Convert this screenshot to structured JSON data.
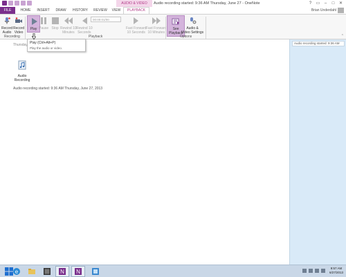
{
  "app": {
    "context_tab_group": "AUDIO & VIDEO",
    "window_title": "Audio recording started: 9:36 AM Thursday, June 27 - OneNote",
    "user": "Brian Underdahl"
  },
  "tabs": [
    {
      "label": "FILE"
    },
    {
      "label": "HOME"
    },
    {
      "label": "INSERT"
    },
    {
      "label": "DRAW"
    },
    {
      "label": "HISTORY"
    },
    {
      "label": "REVIEW"
    },
    {
      "label": "VIEW"
    },
    {
      "label": "PLAYBACK"
    }
  ],
  "ribbon": {
    "groups": {
      "recording": "Recording",
      "playback": "Playback",
      "options": "Options"
    },
    "buttons": {
      "record_audio": "Record\nAudio",
      "record_video": "Record\nVideo",
      "play": "Play",
      "pause": "Pause",
      "stop": "Stop",
      "rewind10m": "Rewind 10\nMinutes",
      "rewind10s": "Rewind 10\nSeconds",
      "ff10s": "Fast Forward\n10 Seconds",
      "ff10m": "Fast Forward\n10 Minutes",
      "see_playback": "See\nPlayback",
      "av_settings": "Audio &\nVideo Settings"
    },
    "time": "00:00:01/00",
    "colors": {
      "accent": "#7a2f8c",
      "selected": "#d4b4dc"
    }
  },
  "tooltip": {
    "title": "Play (Ctrl+Alt+P)",
    "description": "Play the audio or video."
  },
  "page": {
    "date": "Thursday",
    "attachment_label": "Audio\nRecording",
    "note": "Audio recording started: 9:36 AM Thursday, June 27, 2013"
  },
  "pane": {
    "items": [
      "Audio recording started: 9:36 AM"
    ]
  },
  "taskbar": {
    "time": "9:57 AM",
    "date": "6/27/2013",
    "icons": [
      "ie-icon",
      "explorer-icon",
      "media-icon",
      "onenote-icon",
      "onenote-icon-2",
      "paint-icon"
    ]
  }
}
